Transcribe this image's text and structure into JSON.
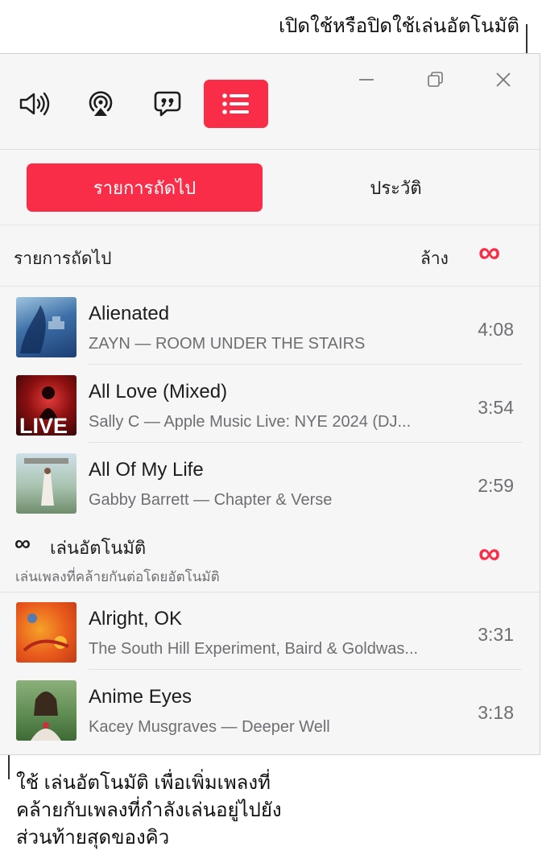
{
  "callouts": {
    "top": "เปิดใช้หรือปิดใช้เล่นอัตโนมัติ",
    "bottom_lines": [
      "ใช้ เล่นอัตโนมัติ เพื่อเพิ่มเพลงที่",
      "คล้ายกับเพลงที่กำลังเล่นอยู่ไปยัง",
      "ส่วนท้ายสุดของคิว"
    ]
  },
  "toolbar": {
    "icons": [
      "speaker-volume-icon",
      "airplay-icon",
      "lyrics-icon",
      "playing-next-icon"
    ],
    "active_color": "#fa2d48"
  },
  "tabs": {
    "up_next": "รายการถัดไป",
    "history": "ประวัติ"
  },
  "queue": {
    "title": "รายการถัดไป",
    "clear_label": "ล้าง",
    "autoplay_symbol": "∞",
    "songs": [
      {
        "title": "Alienated",
        "subtitle": "ZAYN — ROOM UNDER THE STAIRS",
        "duration": "4:08"
      },
      {
        "title": "All Love (Mixed)",
        "subtitle": "Sally C — Apple Music Live: NYE 2024 (DJ...",
        "duration": "3:54",
        "art_text": "LIVE"
      },
      {
        "title": "All Of My Life",
        "subtitle": "Gabby Barrett — Chapter & Verse",
        "duration": "2:59"
      }
    ]
  },
  "autoplay": {
    "symbol": "∞",
    "title": "เล่นอัตโนมัติ",
    "description": "เล่นเพลงที่คล้ายกันต่อโดยอัตโนมัติ",
    "songs": [
      {
        "title": "Alright, OK",
        "subtitle": "The South Hill Experiment, Baird & Goldwas...",
        "duration": "3:31"
      },
      {
        "title": "Anime Eyes",
        "subtitle": "Kacey Musgraves — Deeper Well",
        "duration": "3:18"
      }
    ]
  },
  "colors": {
    "accent": "#fa2d48",
    "secondary_text": "#6e6e73"
  }
}
